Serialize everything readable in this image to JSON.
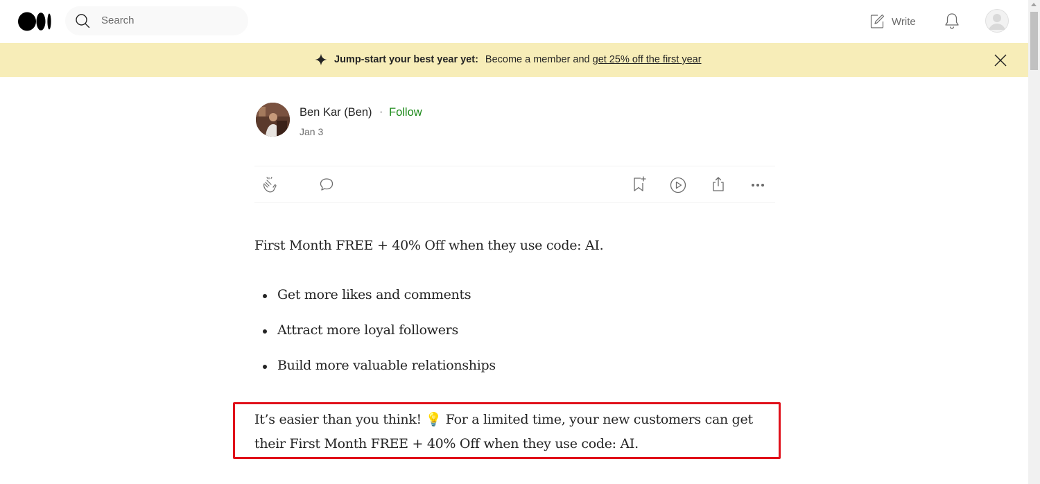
{
  "nav": {
    "search_placeholder": "Search",
    "write_label": "Write"
  },
  "banner": {
    "bold_text": "Jump-start your best year yet:",
    "text": "Become a member and",
    "link_text": "get 25% off the first year",
    "background": "#f7edb8"
  },
  "author": {
    "name": "Ben Kar (Ben)",
    "separator": "·",
    "follow_label": "Follow",
    "date": "Jan 3"
  },
  "actions": {
    "icons": [
      "clap-icon",
      "comment-icon",
      "bookmark-add-icon",
      "play-icon",
      "share-icon",
      "more-icon"
    ]
  },
  "article": {
    "paragraph_1": "First Month FREE + 40% Off when they use code: AI.",
    "bullets": [
      "Get more likes and comments",
      "Attract more loyal followers",
      "Build more valuable relationships"
    ],
    "paragraph_2": "It’s easier than you think! 💡 For a limited time, your new customers can get their First Month FREE + 40% Off when they use code: AI."
  },
  "colors": {
    "follow": "#1a8917",
    "highlight_border": "#e0101a"
  }
}
